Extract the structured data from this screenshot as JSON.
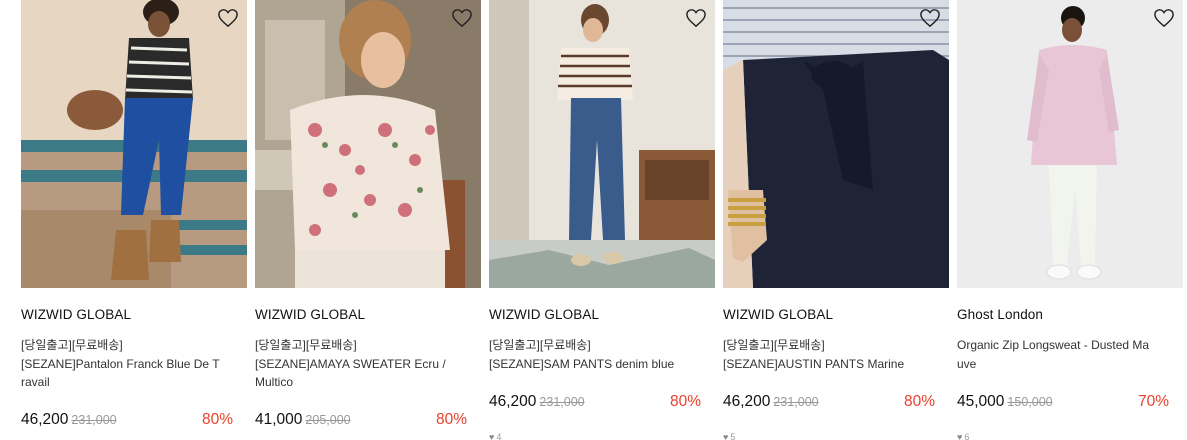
{
  "products": [
    {
      "brand": "WIZWID GLOBAL",
      "title_line1": "[당일출고][무료배송]",
      "title_line2": "[SEZANE]Pantalon Franck Blue De T",
      "title_line3": "ravail",
      "price": "46,200",
      "original_price": "231,000",
      "discount": "80%",
      "likes": ""
    },
    {
      "brand": "WIZWID GLOBAL",
      "title_line1": "[당일출고][무료배송]",
      "title_line2": "[SEZANE]AMAYA SWEATER Ecru /",
      "title_line3": "Multico",
      "price": "41,000",
      "original_price": "205,000",
      "discount": "80%",
      "likes": ""
    },
    {
      "brand": "WIZWID GLOBAL",
      "title_line1": "[당일출고][무료배송]",
      "title_line2": "[SEZANE]SAM PANTS denim blue",
      "title_line3": "",
      "price": "46,200",
      "original_price": "231,000",
      "discount": "80%",
      "likes": "4"
    },
    {
      "brand": "WIZWID GLOBAL",
      "title_line1": "[당일출고][무료배송]",
      "title_line2": "[SEZANE]AUSTIN PANTS Marine",
      "title_line3": "",
      "price": "46,200",
      "original_price": "231,000",
      "discount": "80%",
      "likes": "5"
    },
    {
      "brand": "Ghost London",
      "title_line1": "Organic Zip Longsweat - Dusted Ma",
      "title_line2": "uve",
      "title_line3": "",
      "price": "45,000",
      "original_price": "150,000",
      "discount": "70%",
      "likes": "6"
    }
  ],
  "icons": {
    "wishlist": "heart-outline-icon",
    "likes": "heart-filled-icon"
  },
  "colors": {
    "discount": "#e8402c",
    "original_price": "#999999"
  }
}
